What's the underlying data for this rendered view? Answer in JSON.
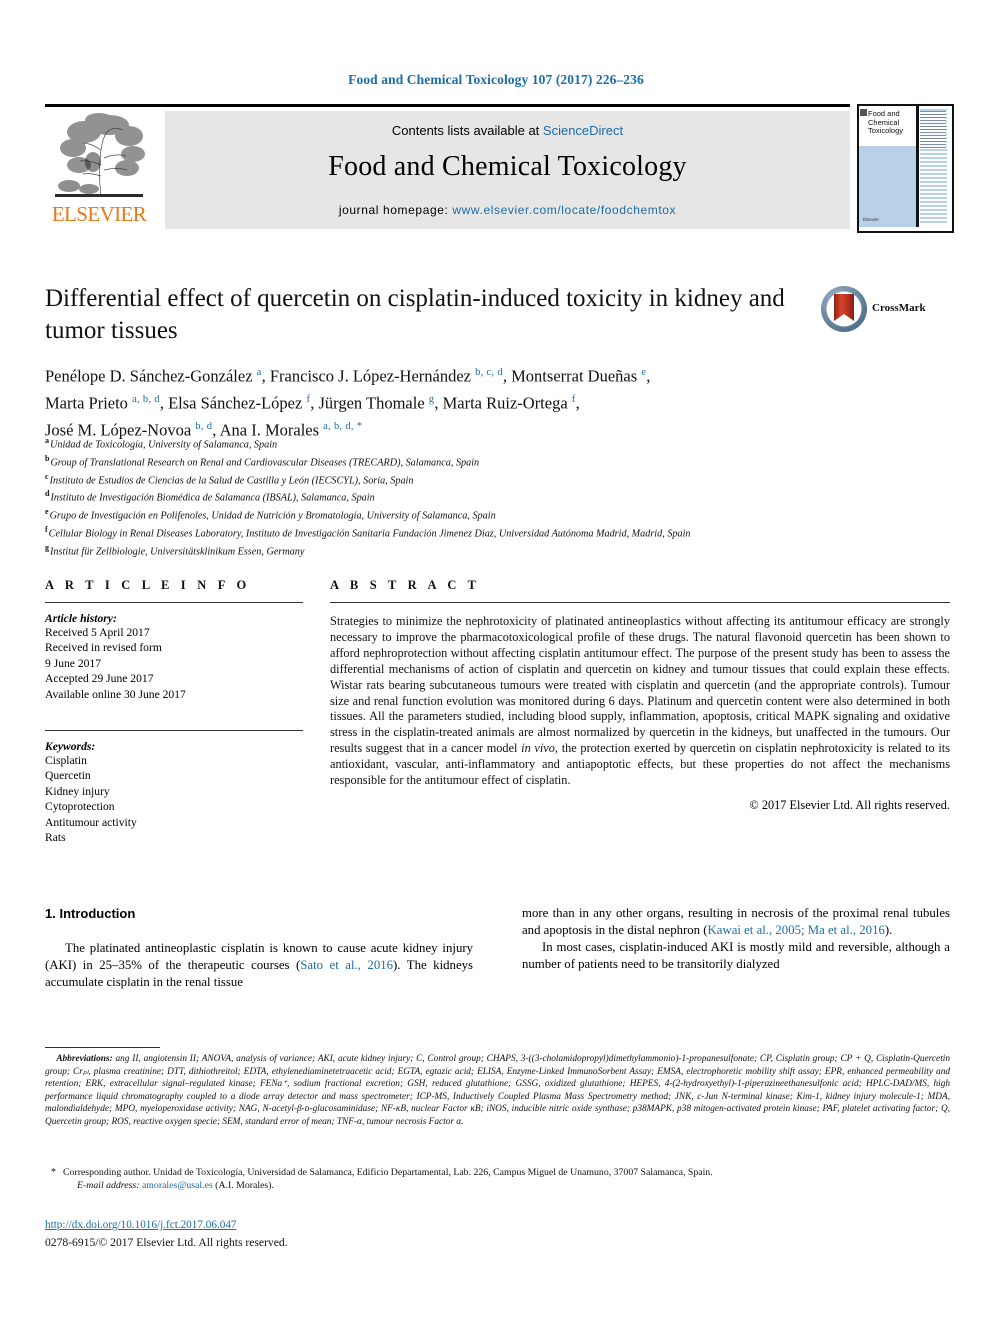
{
  "running_head": "Food and Chemical Toxicology 107 (2017) 226–236",
  "header": {
    "contents_prefix": "Contents lists available at ",
    "sciencedirect": "ScienceDirect",
    "journal_title": "Food and Chemical Toxicology",
    "homepage_label": "journal homepage: ",
    "homepage_url": "www.elsevier.com/locate/foodchemtox",
    "elsevier_wordmark": "ELSEVIER",
    "cover_title": "Food and Chemical Toxicology",
    "cover_publisher": "Elsevier"
  },
  "crossmark": {
    "label": "CrossMark"
  },
  "title": "Differential effect of quercetin on cisplatin-induced toxicity in kidney and tumor tissues",
  "authors_lines": [
    {
      "parts": [
        {
          "name": "Penélope D. Sánchez-González ",
          "sup": "a"
        },
        {
          "name": ", Francisco J. López-Hernández ",
          "sup": "b, c, d"
        },
        {
          "name": ", Montserrat Dueñas ",
          "sup": "e"
        },
        {
          "name": ",",
          "sup": ""
        }
      ]
    },
    {
      "parts": [
        {
          "name": "Marta Prieto ",
          "sup": "a, b, d"
        },
        {
          "name": ", Elsa Sánchez-López ",
          "sup": "f"
        },
        {
          "name": ", Jürgen Thomale ",
          "sup": "g"
        },
        {
          "name": ", Marta Ruiz-Ortega ",
          "sup": "f"
        },
        {
          "name": ",",
          "sup": ""
        }
      ]
    },
    {
      "parts": [
        {
          "name": "José M. López-Novoa ",
          "sup": "b, d"
        },
        {
          "name": ", Ana I. Morales ",
          "sup": "a, b, d, *"
        }
      ]
    }
  ],
  "affiliations": [
    {
      "mark": "a",
      "text": "Unidad de Toxicología, University of Salamanca, Spain"
    },
    {
      "mark": "b",
      "text": "Group of Translational Research on Renal and Cardiovascular Diseases (TRECARD), Salamanca, Spain"
    },
    {
      "mark": "c",
      "text": "Instituto de Estudios de Ciencias de la Salud de Castilla y León (IECSCYL), Soria, Spain"
    },
    {
      "mark": "d",
      "text": "Instituto de Investigación Biomédica de Salamanca (IBSAL), Salamanca, Spain"
    },
    {
      "mark": "e",
      "text": "Grupo de Investigación en Polifenoles, Unidad de Nutrición y Bromatología, University of Salamanca, Spain"
    },
    {
      "mark": "f",
      "text": "Cellular Biology in Renal Diseases Laboratory, Instituto de Investigación Sanitaria Fundación Jimenez Diaz, Universidad Autónoma Madrid, Madrid, Spain"
    },
    {
      "mark": "g",
      "text": "Institut für Zellbiologie, Universitätsklinikum Essen, Germany"
    }
  ],
  "article_info": {
    "heading": "A R T I C L E   I N F O",
    "history_title": "Article history:",
    "history": [
      "Received 5 April 2017",
      "Received in revised form",
      "9 June 2017",
      "Accepted 29 June 2017",
      "Available online 30 June 2017"
    ],
    "keywords_title": "Keywords:",
    "keywords": [
      "Cisplatin",
      "Quercetin",
      "Kidney injury",
      "Cytoprotection",
      "Antitumour activity",
      "Rats"
    ]
  },
  "abstract": {
    "heading": "A B S T R A C T",
    "part1": "Strategies to minimize the nephrotoxicity of platinated antineoplastics without affecting its antitumour efficacy are strongly necessary to improve the pharmacotoxicological profile of these drugs. The natural flavonoid quercetin has been shown to afford nephroprotection without affecting cisplatin antitumour effect. The purpose of the present study has been to assess the differential mechanisms of action of cisplatin and quercetin on kidney and tumour tissues that could explain these effects. Wistar rats bearing subcutaneous tumours were treated with cisplatin and quercetin (and the appropriate controls). Tumour size and renal function evolution was monitored during 6 days. Platinum and quercetin content were also determined in both tissues. All the parameters studied, including blood supply, inflammation, apoptosis, critical MAPK signaling and oxidative stress in the cisplatin-treated animals are almost normalized by quercetin in the kidneys, but unaffected in the tumours. Our results suggest that in a cancer model ",
    "italic": "in vivo",
    "part2": ", the protection exerted by quercetin on cisplatin nephrotoxicity is related to its antioxidant, vascular, anti-inflammatory and antiapoptotic effects, but these properties do not affect the mechanisms responsible for the antitumour effect of cisplatin.",
    "copyright": "© 2017 Elsevier Ltd. All rights reserved."
  },
  "introduction": {
    "heading": "1. Introduction",
    "left_para_a": "The platinated antineoplastic cisplatin is known to cause acute kidney injury (AKI) in 25–35% of the therapeutic courses (",
    "left_ref_a": "Sato et al., 2016",
    "left_para_b": "). The kidneys accumulate cisplatin in the renal tissue",
    "right_para_a": "more than in any other organs, resulting in necrosis of the proximal renal tubules and apoptosis in the distal nephron (",
    "right_ref_a": "Kawai et al., 2005; Ma et al., 2016",
    "right_para_b": ").",
    "right_para_c": "In most cases, cisplatin-induced AKI is mostly mild and reversible, although a number of patients need to be transitorily dialyzed"
  },
  "footnotes": {
    "abbrev_label": "Abbreviations:",
    "abbrev_text": " ang II, angiotensin II; ANOVA, analysis of variance; AKI, acute kidney injury; C, Control group; CHAPS, 3-((3-cholamidopropyl)dimethylammonio)-1-propanesulfonate; CP, Cisplatin group; CP + Q, Cisplatin-Quercetin group; Crₚₗ, plasma creatinine; DTT, dithiothreitol; EDTA, ethylenediaminetetraacetic acid; EGTA, egtazic acid; ELISA, Enzyme-Linked ImmunoSorbent Assay; EMSA, electrophoretic mobility shift assay; EPR, enhanced permeability and retention; ERK, extracellular signal–regulated kinase; FENa⁺, sodium fractional excretion; GSH, reduced glutathione; GSSG, oxidized glutathione; HEPES, 4-(2-hydroxyethyl)-1-piperazineethanesulfonic acid; HPLC-DAD/MS, high performance liquid chromatography coupled to a diode array detector and mass spectrometer; ICP-MS, Inductively Coupled Plasma Mass Spectrometry method; JNK, c-Jun N-terminal kinase; Kim-1, kidney injury molecule-1; MDA, malondialdehyde; MPO, myeloperoxidase activity; NAG, N-acetyl-β-ᴅ-glucosaminidase; NF-κB, nuclear Factor κB; iNOS, inducible nitric oxide synthase; p38MAPK, p38 mitogen-activated protein kinase; PAF, platelet activating factor; Q, Quercetin group; ROS, reactive oxygen specie; SEM, standard error of mean; TNF-α, tumour necrosis Factor α.",
    "corresponding_star": "*",
    "corresponding_text": "Corresponding author. Unidad de Toxicología, Universidad de Salamanca, Edificio Departamental, Lab. 226, Campus Miguel de Unamuno, 37007 Salamanca, Spain.",
    "email_label": "E-mail address:",
    "email": "amorales@usal.es",
    "email_suffix": " (A.I. Morales).",
    "doi": "http://dx.doi.org/10.1016/j.fct.2017.06.047",
    "issn_line": "0278-6915/© 2017 Elsevier Ltd. All rights reserved."
  },
  "colors": {
    "link_blue": "#1b6ca8",
    "elsevier_orange": "#E77817",
    "banner_gray": "#e6e6e6",
    "crossmark_red": "#C0392B",
    "cover_blue": "#b9d1e8"
  }
}
